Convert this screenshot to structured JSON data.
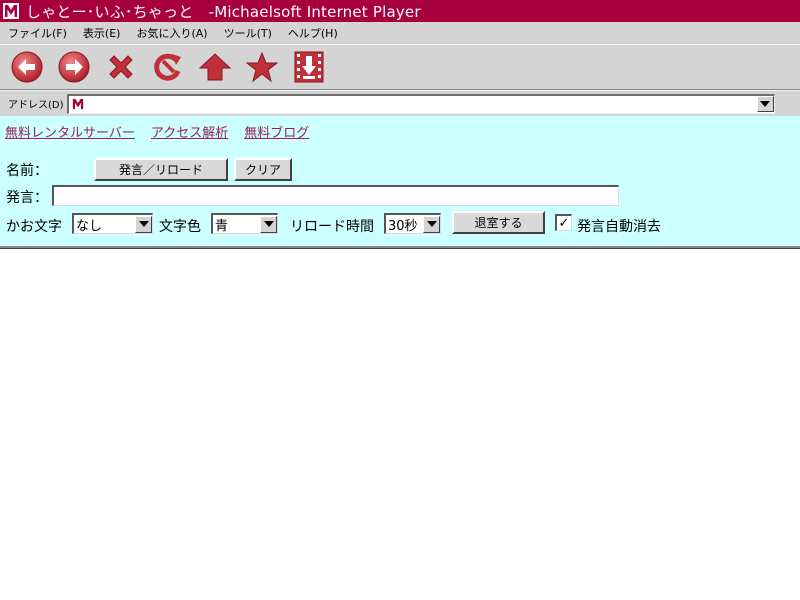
{
  "window": {
    "title": "しゃとー･いふ･ちゃっと　-Michaelsoft Internet Player"
  },
  "menu": {
    "items": [
      "ファイル(F)",
      "表示(E)",
      "お気に入り(A)",
      "ツール(T)",
      "ヘルプ(H)"
    ]
  },
  "toolbar": {
    "icons": [
      "back-arrow-icon",
      "forward-arrow-icon",
      "stop-x-icon",
      "refresh-icon",
      "home-arrow-icon",
      "favorites-star-icon",
      "download-icon"
    ]
  },
  "address": {
    "label": "アドレス(D)",
    "value": ""
  },
  "links": [
    "無料レンタルサーバー",
    "アクセス解析",
    "無料ブログ"
  ],
  "form": {
    "name_label": "名前：",
    "post_reload_button": "発言／リロード",
    "clear_button": "クリア",
    "message_label": "発言：",
    "message_value": "",
    "kaomoji_label": "かお文字",
    "kaomoji_value": "なし",
    "color_label": "文字色",
    "color_value": "青",
    "reload_label": "リロード時間",
    "reload_value": "30秒",
    "leave_button": "退室する",
    "auto_clear_label": "発言自動消去",
    "auto_clear_checked": "✓"
  },
  "colors": {
    "titlebar": "#a8003c",
    "chrome": "#d4d4d4",
    "content_bg": "#ccffff",
    "link": "#9a1f5a",
    "icon_red": "#c0303a"
  }
}
